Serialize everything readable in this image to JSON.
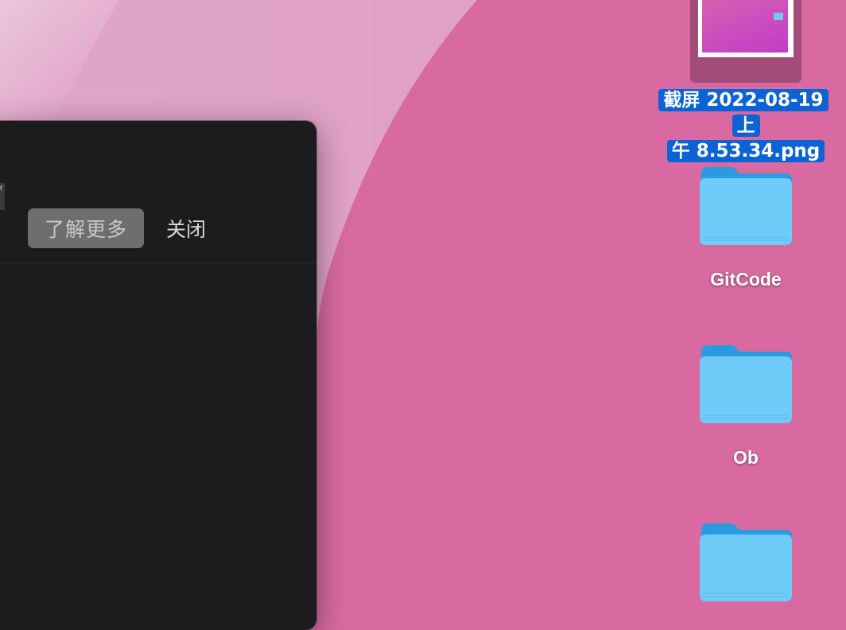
{
  "dialog": {
    "edge_char": "r",
    "learn_more_label": "了解更多",
    "close_label": "关闭"
  },
  "desktop": {
    "screenshot_file": {
      "name_line1": "截屏 2022-08-19 上",
      "name_line2": "午 8.53.34.png"
    },
    "folders": [
      {
        "label": "GitCode"
      },
      {
        "label": "Ob"
      },
      {
        "label": ""
      }
    ]
  },
  "colors": {
    "wallpaper": "#d86aa1",
    "window": "#1c1c1e",
    "selection": "#0b63d6",
    "folder": "#6fcbf7"
  }
}
